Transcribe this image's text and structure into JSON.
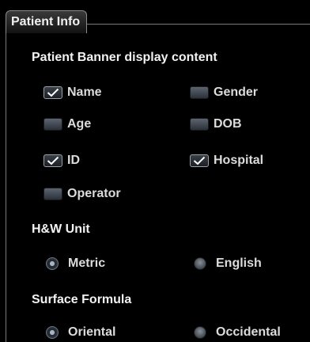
{
  "group": {
    "title": "Patient Info"
  },
  "banner": {
    "heading": "Patient Banner display content",
    "options": [
      {
        "label": "Name",
        "checked": true
      },
      {
        "label": "Gender",
        "checked": false
      },
      {
        "label": "Age",
        "checked": false
      },
      {
        "label": "DOB",
        "checked": false
      },
      {
        "label": "ID",
        "checked": true
      },
      {
        "label": "Hospital",
        "checked": true
      },
      {
        "label": "Operator",
        "checked": false
      }
    ]
  },
  "hw_unit": {
    "heading": "H&W Unit",
    "options": [
      {
        "label": "Metric",
        "selected": true
      },
      {
        "label": "English",
        "selected": false
      }
    ]
  },
  "surface_formula": {
    "heading": "Surface Formula",
    "options": [
      {
        "label": "Oriental",
        "selected": true
      },
      {
        "label": "Occidental",
        "selected": false
      }
    ]
  },
  "colors": {
    "background": "#000000",
    "text": "#dcdcdc",
    "frame": "#7a7a7a"
  }
}
